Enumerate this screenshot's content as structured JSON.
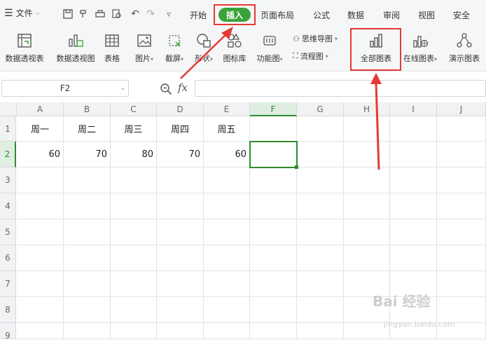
{
  "menubar": {
    "file_label": "文件",
    "tabs": [
      "开始",
      "插入",
      "页面布局",
      "公式",
      "数据",
      "审阅",
      "视图",
      "安全"
    ],
    "active_tab": "插入"
  },
  "ribbon": {
    "buttons": [
      "数据透视表",
      "数据透视图",
      "表格",
      "图片",
      "截屏",
      "形状",
      "图标库",
      "功能图",
      "全部图表",
      "在线图表",
      "演示图表"
    ],
    "small_buttons": [
      "思维导图",
      "流程图"
    ]
  },
  "formula_bar": {
    "name_box": "F2",
    "fx_label": "fx",
    "formula": ""
  },
  "sheet": {
    "columns": [
      "A",
      "B",
      "C",
      "D",
      "E",
      "F",
      "G",
      "H",
      "I",
      "J"
    ],
    "rows": [
      "1",
      "2",
      "3",
      "4",
      "5",
      "6",
      "7",
      "8",
      "9"
    ],
    "active_column": "F",
    "active_row": "2",
    "row1": [
      "周一",
      "周二",
      "周三",
      "周四",
      "周五"
    ],
    "row2": [
      "60",
      "70",
      "80",
      "70",
      "60"
    ]
  },
  "watermark": {
    "main": "Bai 经验",
    "sub": "jingyan.baidu.com"
  },
  "colors": {
    "accent_green": "#3aa23a",
    "highlight_red": "#e53935"
  }
}
